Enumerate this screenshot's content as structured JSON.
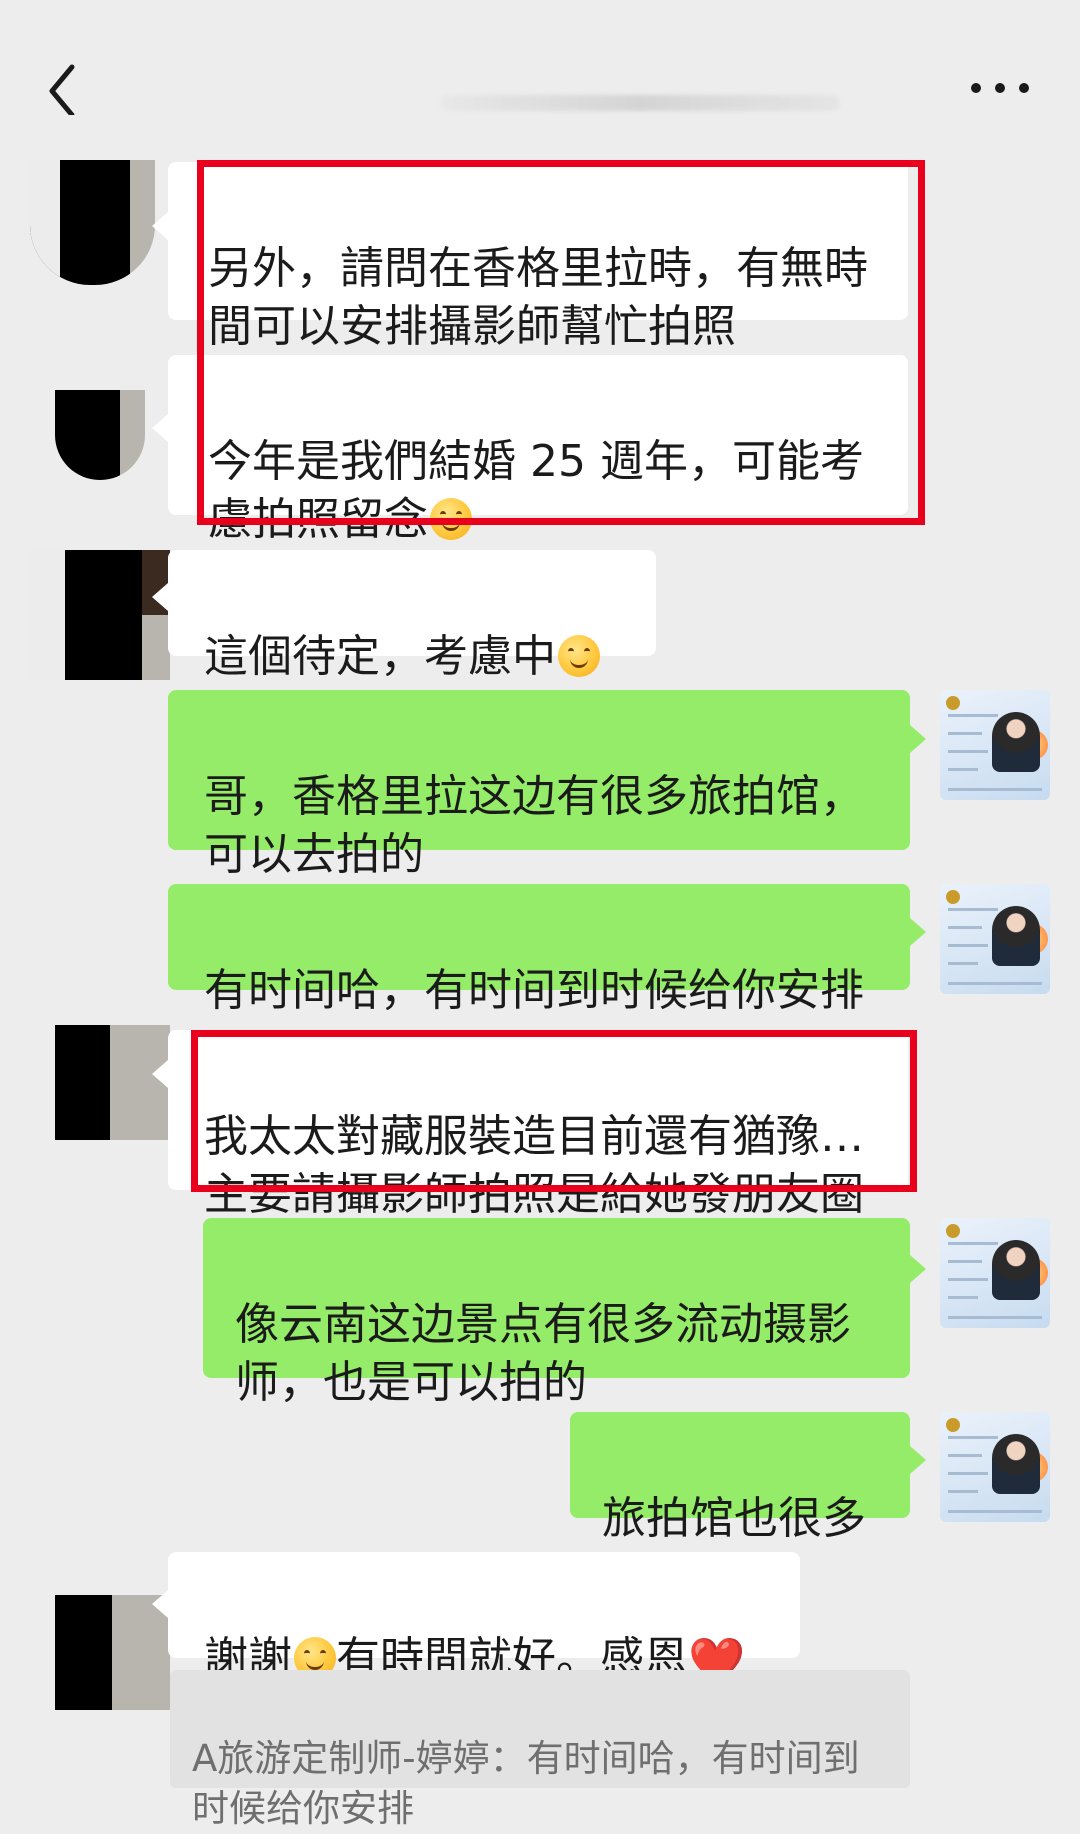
{
  "header": {
    "back_icon": "chevron-left-icon",
    "more_icon": "ellipsis-icon"
  },
  "messages": [
    {
      "side": "left",
      "text": "另外，請問在香格里拉時，有無時\n間可以安排攝影師幫忙拍照"
    },
    {
      "side": "left",
      "text": "今年是我們結婚 25 週年，可能考\n慮拍照留念",
      "emoji": "smile"
    },
    {
      "side": "left",
      "text": "這個待定，考慮中",
      "emoji": "smile"
    },
    {
      "side": "right",
      "text": "哥，香格里拉这边有很多旅拍馆，\n可以去拍的"
    },
    {
      "side": "right",
      "text": "有时间哈，有时间到时候给你安排"
    },
    {
      "side": "left",
      "text": "我太太對藏服裝造目前還有猶豫…\n主要請攝影師拍照是給她發朋友圈"
    },
    {
      "side": "right",
      "text": "像云南这边景点有很多流动摄影\n师，也是可以拍的"
    },
    {
      "side": "right",
      "text": "旅拍馆也很多"
    },
    {
      "side": "left",
      "text_before": "謝謝",
      "text_after": "有時間就好。感恩",
      "emoji": "smile",
      "trailing": "❤️"
    }
  ],
  "quote": {
    "text": "A旅游定制师-婷婷：有时间哈，有时间到\n时候给你安排"
  },
  "colors": {
    "background": "#ededed",
    "bubble_left": "#ffffff",
    "bubble_right": "#95ec69",
    "highlight": "#e8001c"
  }
}
